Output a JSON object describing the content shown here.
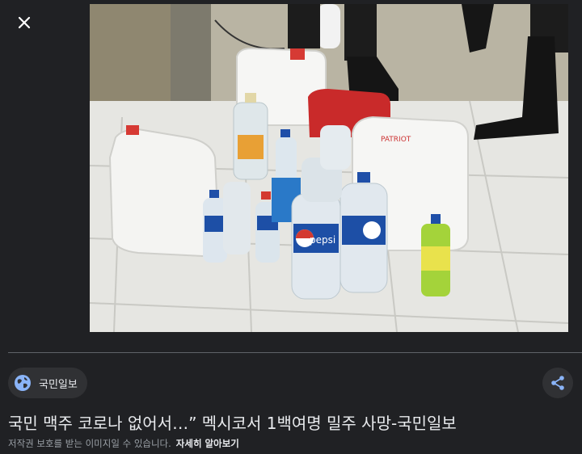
{
  "viewer": {
    "close_label": "close",
    "photo_subject": "plastic jugs and bottles on a tiled floor"
  },
  "photo": {
    "bottle_brand_text": "pepsi",
    "red_can_text": "PATRIOT"
  },
  "source": {
    "name": "국민일보"
  },
  "actions": {
    "share_label": "share"
  },
  "result": {
    "title": "국민 맥주 코로나 없어서…” 멕시코서 1백여명 밀주 사망-국민일보",
    "copyright_note": "저작권 보호를 받는 이미지일 수 있습니다.",
    "learn_more_label": "자세히 알아보기"
  },
  "colors": {
    "background": "#202124",
    "chip_background": "#303134",
    "divider": "#5f6368",
    "muted_text": "#9aa0a6",
    "primary_text": "#e8eaed",
    "share_icon": "#8ab4f8"
  }
}
